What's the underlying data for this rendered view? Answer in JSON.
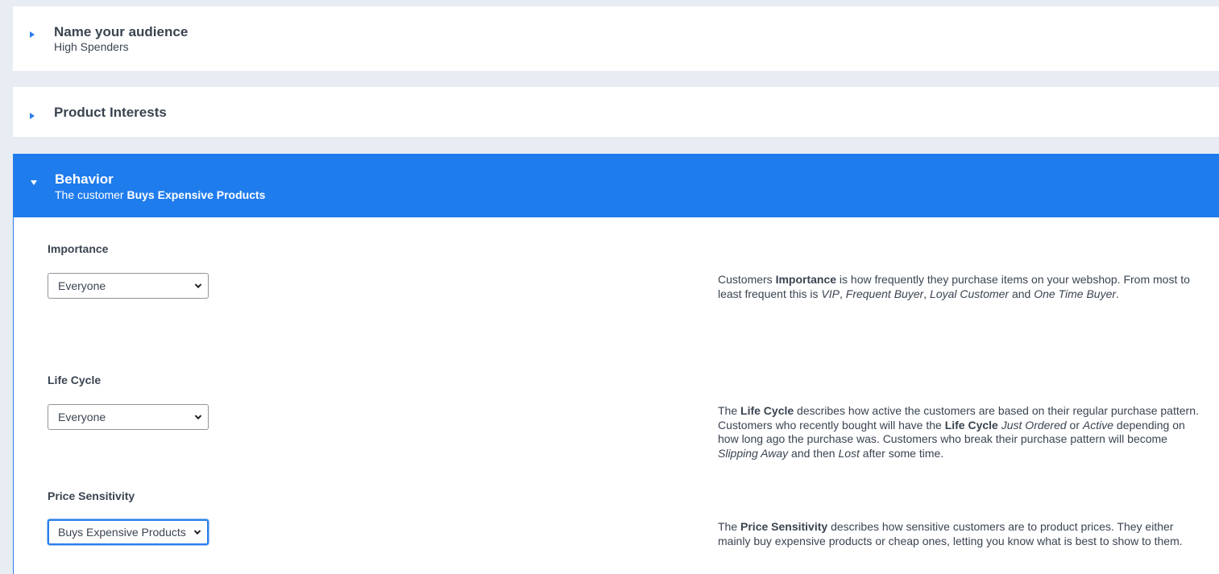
{
  "name_panel": {
    "title": "Name your audience",
    "subtitle": "High Spenders"
  },
  "interests_panel": {
    "title": "Product Interests"
  },
  "behavior_panel": {
    "title": "Behavior",
    "subtitle_prefix": "The customer ",
    "subtitle_value": "Buys Expensive Products"
  },
  "importance": {
    "label": "Importance",
    "selected": "Everyone",
    "desc": {
      "t1": "Customers ",
      "b1": "Importance",
      "t2": " is how frequently they purchase items on your webshop. From most to least frequent this is ",
      "i1": "VIP",
      "t3": ", ",
      "i2": "Frequent Buyer",
      "t4": ", ",
      "i3": "Loyal Customer",
      "t5": " and ",
      "i4": "One Time Buyer",
      "t6": "."
    }
  },
  "life_cycle": {
    "label": "Life Cycle",
    "selected": "Everyone",
    "desc": {
      "t1": "The ",
      "b1": "Life Cycle",
      "t2": " describes how active the customers are based on their regular purchase pattern.",
      "t3": "Customers who recently bought will have the ",
      "b2": "Life Cycle",
      "t4": " ",
      "i1": "Just Ordered",
      "t5": " or ",
      "i2": "Active",
      "t6": " depending on how long ago the purchase was. Customers who break their purchase pattern will become ",
      "i3": "Slipping Away",
      "t7": " and then ",
      "i4": "Lost",
      "t8": " after some time."
    }
  },
  "price_sensitivity": {
    "label": "Price Sensitivity",
    "selected": "Buys Expensive Products",
    "desc": {
      "t1": "The ",
      "b1": "Price Sensitivity",
      "t2": " describes how sensitive customers are to product prices. They either mainly buy expensive products or cheap ones, letting you know what is best to show to them."
    }
  },
  "colors": {
    "accent": "#1f7ced",
    "background": "#e8edf3",
    "text": "#3a4451"
  },
  "icons": {
    "collapsed": "caret-right-icon",
    "expanded": "caret-down-icon",
    "select": "chevron-down-icon"
  }
}
